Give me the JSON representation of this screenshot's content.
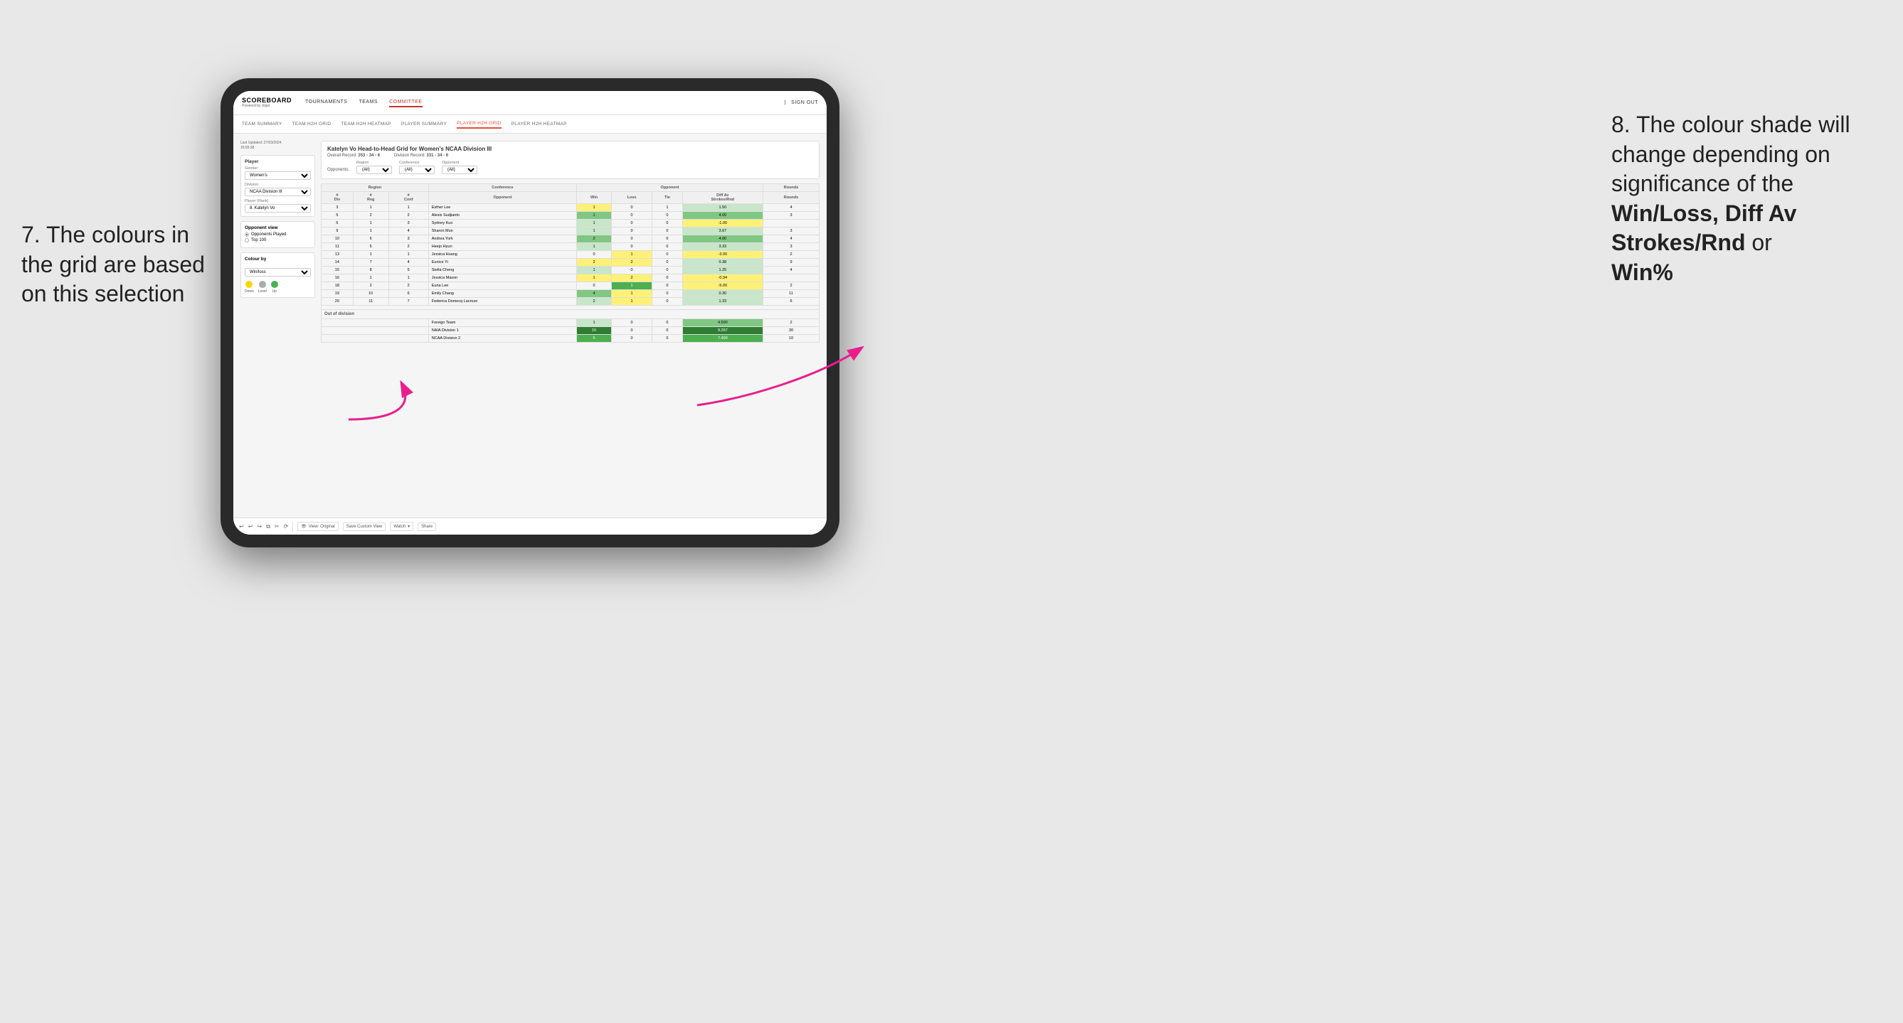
{
  "annotations": {
    "left_title": "7. The colours in the grid are based on this selection",
    "right_title": "8. The colour shade will change depending on significance of the",
    "right_bold1": "Win/Loss, Diff Av Strokes/Rnd",
    "right_bold2": "or",
    "right_bold3": "Win%"
  },
  "nav": {
    "logo": "SCOREBOARD",
    "logo_sub": "Powered by clippi",
    "links": [
      "TOURNAMENTS",
      "TEAMS",
      "COMMITTEE"
    ],
    "active_link": "COMMITTEE",
    "right_links": [
      "Sign out"
    ]
  },
  "sub_nav": {
    "links": [
      "TEAM SUMMARY",
      "TEAM H2H GRID",
      "TEAM H2H HEATMAP",
      "PLAYER SUMMARY",
      "PLAYER H2H GRID",
      "PLAYER H2H HEATMAP"
    ],
    "active": "PLAYER H2H GRID"
  },
  "sidebar": {
    "last_updated": "Last Updated: 27/03/2024\n16:55:38",
    "player_section": {
      "title": "Player",
      "gender_label": "Gender",
      "gender_value": "Women's",
      "division_label": "Division",
      "division_value": "NCAA Division III",
      "player_rank_label": "Player (Rank)",
      "player_rank_value": "8. Katelyn Vo"
    },
    "opponent_view": {
      "title": "Opponent view",
      "options": [
        "Opponents Played",
        "Top 100"
      ]
    },
    "colour_by": {
      "title": "Colour by",
      "value": "Win/loss"
    },
    "legend": {
      "items": [
        {
          "label": "Down",
          "color": "#FFD700"
        },
        {
          "label": "Level",
          "color": "#aaa"
        },
        {
          "label": "Up",
          "color": "#4CAF50"
        }
      ]
    }
  },
  "grid": {
    "title": "Katelyn Vo Head-to-Head Grid for Women's NCAA Division III",
    "overall_record_label": "Overall Record:",
    "overall_record": "353 - 34 - 6",
    "division_record_label": "Division Record:",
    "division_record": "331 - 34 - 6",
    "filters": {
      "opponents_label": "Opponents:",
      "region_label": "Region",
      "region_value": "(All)",
      "conference_label": "Conference",
      "conference_value": "(All)",
      "opponent_label": "Opponent",
      "opponent_value": "(All)"
    },
    "table_headers": {
      "div": "#\nDiv",
      "reg": "#\nReg",
      "conf": "#\nConf",
      "opponent": "Opponent",
      "win": "Win",
      "loss": "Loss",
      "tie": "Tie",
      "diff_av": "Diff Av\nStrokes/Rnd",
      "rounds": "Rounds"
    },
    "rows": [
      {
        "div": "3",
        "reg": "1",
        "conf": "1",
        "opponent": "Esther Lee",
        "win": "1",
        "loss": "0",
        "tie": "1",
        "diff": "1.50",
        "rounds": "4",
        "win_color": "yellow",
        "loss_color": "",
        "diff_color": "green_light"
      },
      {
        "div": "5",
        "reg": "2",
        "conf": "2",
        "opponent": "Alexis Sudjianto",
        "win": "1",
        "loss": "0",
        "tie": "0",
        "diff": "4.00",
        "rounds": "3",
        "win_color": "green_med",
        "loss_color": "",
        "diff_color": "green_med"
      },
      {
        "div": "6",
        "reg": "1",
        "conf": "3",
        "opponent": "Sydney Kuo",
        "win": "1",
        "loss": "0",
        "tie": "0",
        "diff": "-1.00",
        "rounds": "",
        "win_color": "green_light",
        "loss_color": "",
        "diff_color": "yellow"
      },
      {
        "div": "9",
        "reg": "1",
        "conf": "4",
        "opponent": "Sharon Mun",
        "win": "1",
        "loss": "0",
        "tie": "0",
        "diff": "3.67",
        "rounds": "3",
        "win_color": "green_light",
        "loss_color": "",
        "diff_color": "green_light"
      },
      {
        "div": "10",
        "reg": "6",
        "conf": "3",
        "opponent": "Andrea York",
        "win": "2",
        "loss": "0",
        "tie": "0",
        "diff": "4.00",
        "rounds": "4",
        "win_color": "green_med",
        "loss_color": "",
        "diff_color": "green_med"
      },
      {
        "div": "11",
        "reg": "5",
        "conf": "2",
        "opponent": "Heejo Hyun",
        "win": "1",
        "loss": "0",
        "tie": "0",
        "diff": "3.33",
        "rounds": "3",
        "win_color": "green_light",
        "loss_color": "",
        "diff_color": "green_light"
      },
      {
        "div": "13",
        "reg": "1",
        "conf": "1",
        "opponent": "Jessica Huang",
        "win": "0",
        "loss": "1",
        "tie": "0",
        "diff": "-3.00",
        "rounds": "2",
        "win_color": "",
        "loss_color": "yellow",
        "diff_color": "yellow"
      },
      {
        "div": "14",
        "reg": "7",
        "conf": "4",
        "opponent": "Eunice Yi",
        "win": "2",
        "loss": "2",
        "tie": "0",
        "diff": "0.38",
        "rounds": "9",
        "win_color": "yellow",
        "loss_color": "yellow",
        "diff_color": "green_light"
      },
      {
        "div": "15",
        "reg": "8",
        "conf": "5",
        "opponent": "Stella Cheng",
        "win": "1",
        "loss": "0",
        "tie": "0",
        "diff": "1.25",
        "rounds": "4",
        "win_color": "green_light",
        "loss_color": "",
        "diff_color": "green_light"
      },
      {
        "div": "16",
        "reg": "1",
        "conf": "1",
        "opponent": "Jessica Mason",
        "win": "1",
        "loss": "2",
        "tie": "0",
        "diff": "-0.94",
        "rounds": "",
        "win_color": "yellow",
        "loss_color": "yellow",
        "diff_color": "yellow"
      },
      {
        "div": "18",
        "reg": "2",
        "conf": "2",
        "opponent": "Euna Lee",
        "win": "0",
        "loss": "1",
        "tie": "0",
        "diff": "-5.00",
        "rounds": "2",
        "win_color": "",
        "loss_color": "green_dark",
        "diff_color": "yellow"
      },
      {
        "div": "19",
        "reg": "10",
        "conf": "6",
        "opponent": "Emily Chang",
        "win": "4",
        "loss": "1",
        "tie": "0",
        "diff": "0.30",
        "rounds": "11",
        "win_color": "green_med",
        "loss_color": "yellow",
        "diff_color": "green_light"
      },
      {
        "div": "20",
        "reg": "11",
        "conf": "7",
        "opponent": "Federica Domecq Lacroze",
        "win": "2",
        "loss": "1",
        "tie": "0",
        "diff": "1.33",
        "rounds": "6",
        "win_color": "green_light",
        "loss_color": "yellow",
        "diff_color": "green_light"
      }
    ],
    "out_of_division": {
      "title": "Out of division",
      "rows": [
        {
          "opponent": "Foreign Team",
          "win": "1",
          "loss": "0",
          "tie": "0",
          "diff": "4.500",
          "rounds": "2",
          "win_color": "green_light"
        },
        {
          "opponent": "NAIA Division 1",
          "win": "15",
          "loss": "0",
          "tie": "0",
          "diff": "9.267",
          "rounds": "30",
          "win_color": "green_dark"
        },
        {
          "opponent": "NCAA Division 2",
          "win": "5",
          "loss": "0",
          "tie": "0",
          "diff": "7.400",
          "rounds": "10",
          "win_color": "green_med"
        }
      ]
    }
  },
  "toolbar": {
    "buttons": [
      "View: Original",
      "Save Custom View",
      "Watch",
      "Share"
    ]
  }
}
